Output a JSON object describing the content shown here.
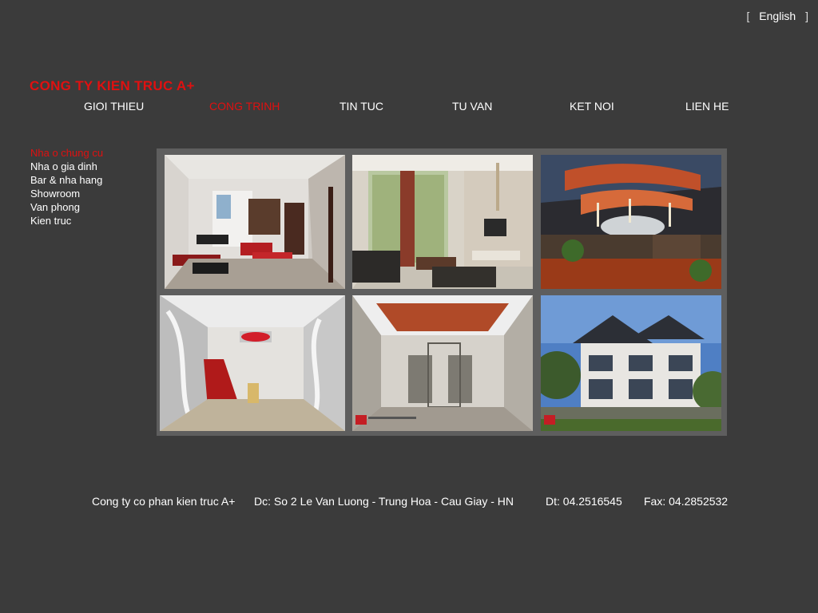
{
  "language": {
    "open_bracket": "[",
    "label": "English",
    "close_bracket": "]"
  },
  "brand": "CONG TY KIEN TRUC A+",
  "nav": {
    "items": [
      {
        "label": "GIOI THIEU",
        "active": false
      },
      {
        "label": "CONG TRINH",
        "active": true
      },
      {
        "label": "TIN TUC",
        "active": false
      },
      {
        "label": "TU VAN",
        "active": false
      },
      {
        "label": "KET NOI",
        "active": false
      },
      {
        "label": "LIEN HE",
        "active": false
      }
    ]
  },
  "sidenav": {
    "items": [
      {
        "label": "Nha o chung cu",
        "active": true
      },
      {
        "label": "Nha o gia dinh",
        "active": false
      },
      {
        "label": "Bar & nha hang",
        "active": false
      },
      {
        "label": "Showroom",
        "active": false
      },
      {
        "label": "Van phong",
        "active": false
      },
      {
        "label": "Kien truc",
        "active": false
      }
    ]
  },
  "colors": {
    "background": "#3b3b3b",
    "accent": "#e01010",
    "gallery_frame": "#5e5e5e",
    "text": "#ffffff"
  },
  "footer": {
    "company": "Cong ty co phan kien truc A+",
    "address": "Dc: So 2 Le Van Luong - Trung Hoa - Cau Giay - HN",
    "phone": "Dt: 04.2516545",
    "fax": "Fax: 04.2852532"
  }
}
